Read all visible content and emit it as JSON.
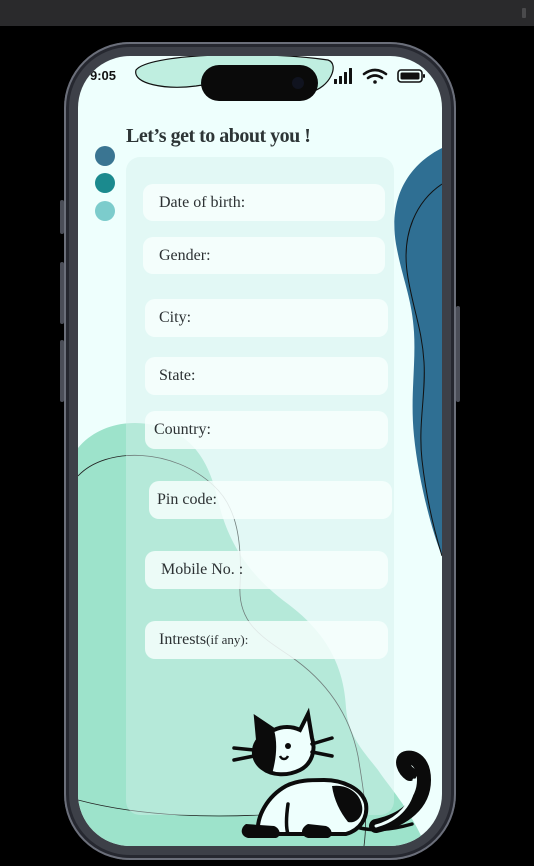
{
  "status_bar": {
    "time": "9:05"
  },
  "form": {
    "heading": "Let’s get to about you !",
    "fields": [
      {
        "label": "Date of birth:",
        "hint": ""
      },
      {
        "label": "Gender:",
        "hint": ""
      },
      {
        "label": "City:",
        "hint": ""
      },
      {
        "label": "State:",
        "hint": ""
      },
      {
        "label": "Country:",
        "hint": ""
      },
      {
        "label": "Pin code:",
        "hint": ""
      },
      {
        "label": "Mobile No. :",
        "hint": ""
      },
      {
        "label": "Intrests",
        "hint": "(if any):"
      }
    ]
  },
  "colors": {
    "step_1": "#3a7592",
    "step_2": "#1b8a8e",
    "step_3": "#7ccccc",
    "blob_blue": "#2f6f93",
    "blob_mint": "#9de3cb",
    "screen_bg": "#eefffd"
  },
  "icons": [
    "signal-icon",
    "wifi-icon",
    "battery-icon",
    "cat-illustration"
  ]
}
